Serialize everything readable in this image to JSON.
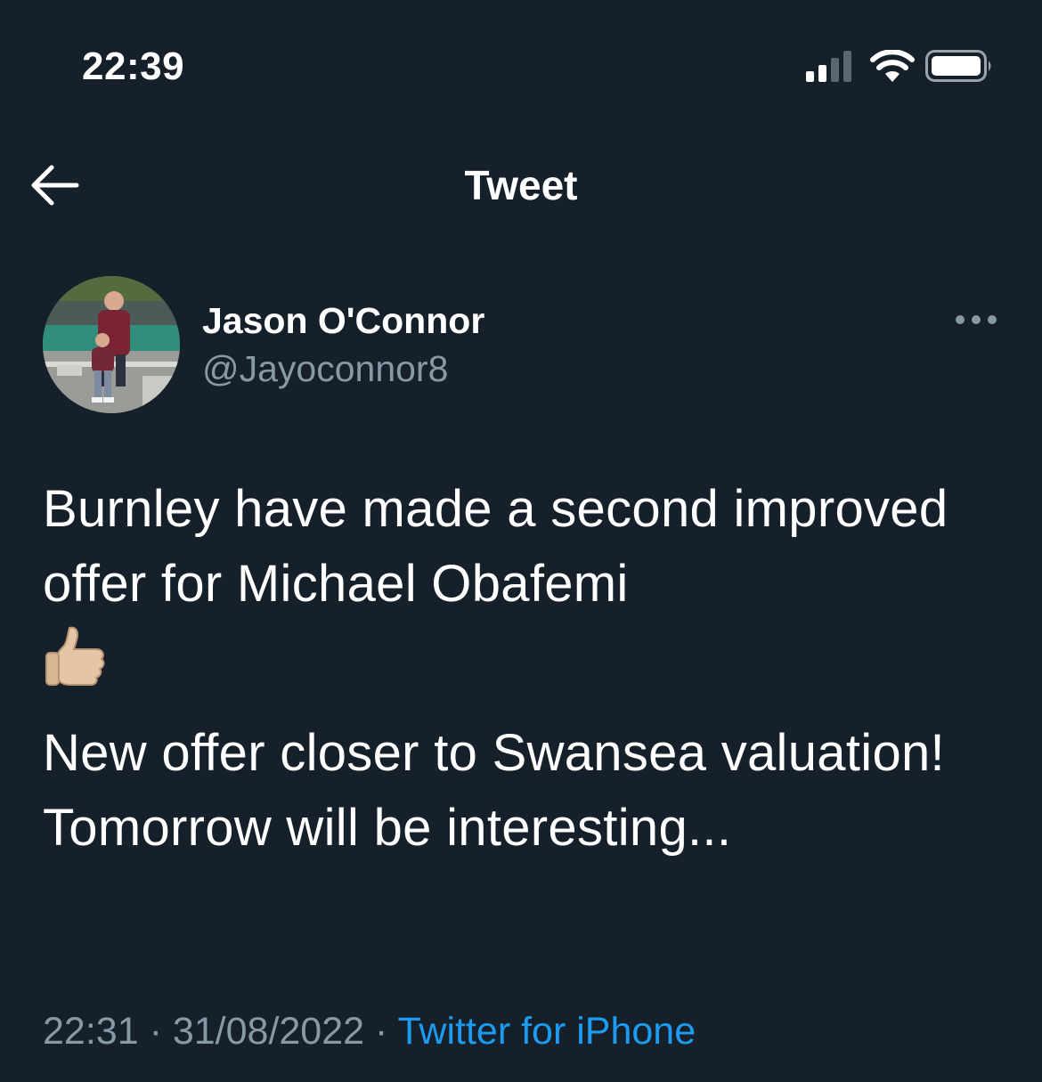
{
  "status_bar": {
    "time": "22:39",
    "icons": [
      "cellular-signal-icon",
      "wifi-icon",
      "battery-icon"
    ]
  },
  "nav": {
    "back_icon": "arrow-left-icon",
    "title": "Tweet"
  },
  "tweet": {
    "author": {
      "name": "Jason O'Connor",
      "handle": "@Jayoconnor8",
      "avatar_icon": "profile-photo"
    },
    "more_icon": "more-horizontal-icon",
    "text_paragraph_1": "Burnley have made a second improved offer for Michael Obafemi",
    "emoji": "thumbs-up-emoji",
    "text_paragraph_2": "New offer closer to Swansea valuation! Tomorrow will be interesting...",
    "time": "22:31",
    "separator": "·",
    "date": "31/08/2022",
    "source": "Twitter for iPhone"
  },
  "colors": {
    "background": "#15202b",
    "text_primary": "#ffffff",
    "text_secondary": "#8899a6",
    "link": "#1d9bf0"
  }
}
